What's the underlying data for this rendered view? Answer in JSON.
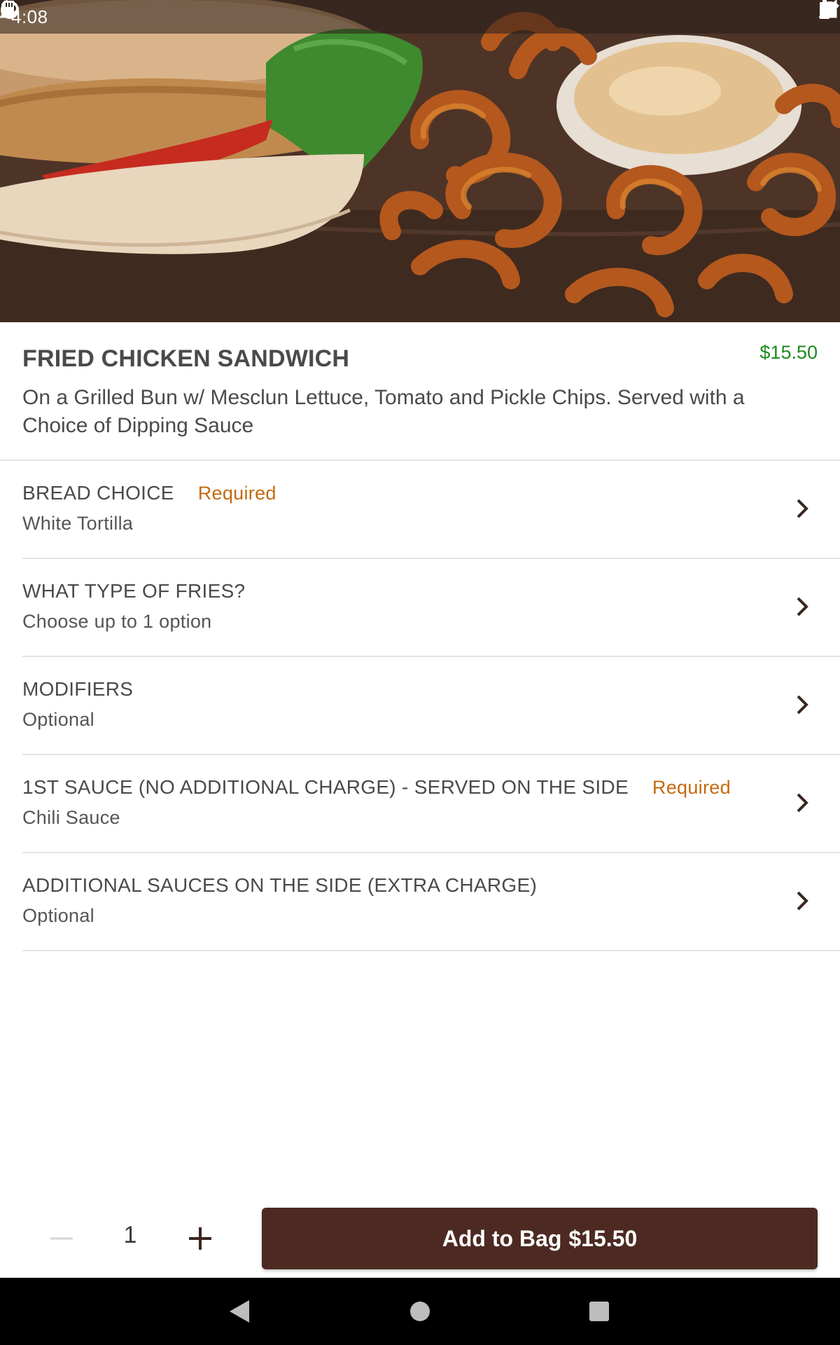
{
  "status_bar": {
    "time": "4:08",
    "left_icons": [
      "data-transfer-icon",
      "app-icon",
      "sd-card-icon"
    ],
    "right_icons": [
      "wifi-icon",
      "signal-icon",
      "battery-icon"
    ]
  },
  "hero": {
    "image": "fried-chicken-sandwich-with-curly-fries-photo"
  },
  "item": {
    "title": "FRIED CHICKEN SANDWICH",
    "price": "$15.50",
    "description": "On a Grilled Bun w/ Mesclun Lettuce, Tomato and Pickle Chips. Served with a Choice of Dipping Sauce"
  },
  "options": [
    {
      "title": "BREAD CHOICE",
      "required": "Required",
      "subtitle": "White Tortilla"
    },
    {
      "title": "WHAT TYPE OF FRIES?",
      "required": "",
      "subtitle": "Choose up to 1 option"
    },
    {
      "title": "MODIFIERS",
      "required": "",
      "subtitle": "Optional"
    },
    {
      "title": "1ST SAUCE (NO ADDITIONAL CHARGE) - SERVED ON THE SIDE",
      "required": "Required",
      "subtitle": "Chili Sauce"
    },
    {
      "title": "ADDITIONAL SAUCES ON THE SIDE (EXTRA CHARGE)",
      "required": "",
      "subtitle": "Optional"
    }
  ],
  "quantity": {
    "value": "1"
  },
  "add_button": {
    "label": "Add to Bag",
    "price": "$15.50"
  },
  "colors": {
    "primary_button": "#4c2a22",
    "price_green": "#1e8a1e",
    "required_orange": "#c46a0f"
  }
}
